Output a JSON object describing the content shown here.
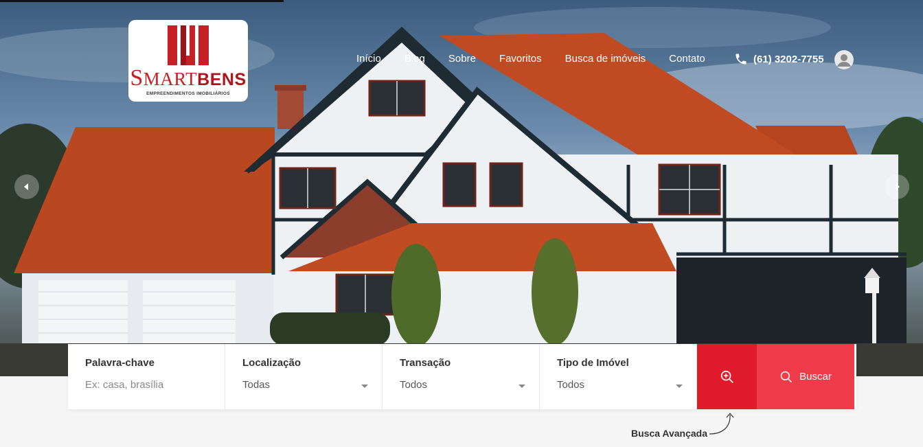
{
  "logo": {
    "brand_first": "S",
    "brand_mid": "MART",
    "brand_last": "BENS",
    "tagline": "EMPREENDIMENTOS IMOBILIÁRIOS"
  },
  "nav": {
    "items": [
      "Início",
      "Blog",
      "Sobre",
      "Favoritos",
      "Busca de imóveis",
      "Contato"
    ]
  },
  "contact": {
    "phone": "(61) 3202-7755",
    "phone_icon": "phone-icon",
    "user_icon": "user-icon"
  },
  "slider": {
    "prev_icon": "chevron-left-icon",
    "next_icon": "chevron-right-icon"
  },
  "search": {
    "keyword": {
      "label": "Palavra-chave",
      "placeholder": "Ex: casa, brasília"
    },
    "location": {
      "label": "Localização",
      "value": "Todas"
    },
    "transaction": {
      "label": "Transação",
      "value": "Todos"
    },
    "property_type": {
      "label": "Tipo de Imóvel",
      "value": "Todos"
    },
    "advanced_icon": "zoom-in-icon",
    "search_icon": "search-icon",
    "search_label": "Buscar",
    "advanced_note": "Busca Avançada"
  },
  "colors": {
    "primary_red": "#e01c2c",
    "secondary_red": "#f03c4a",
    "brand_red": "#c42025"
  }
}
